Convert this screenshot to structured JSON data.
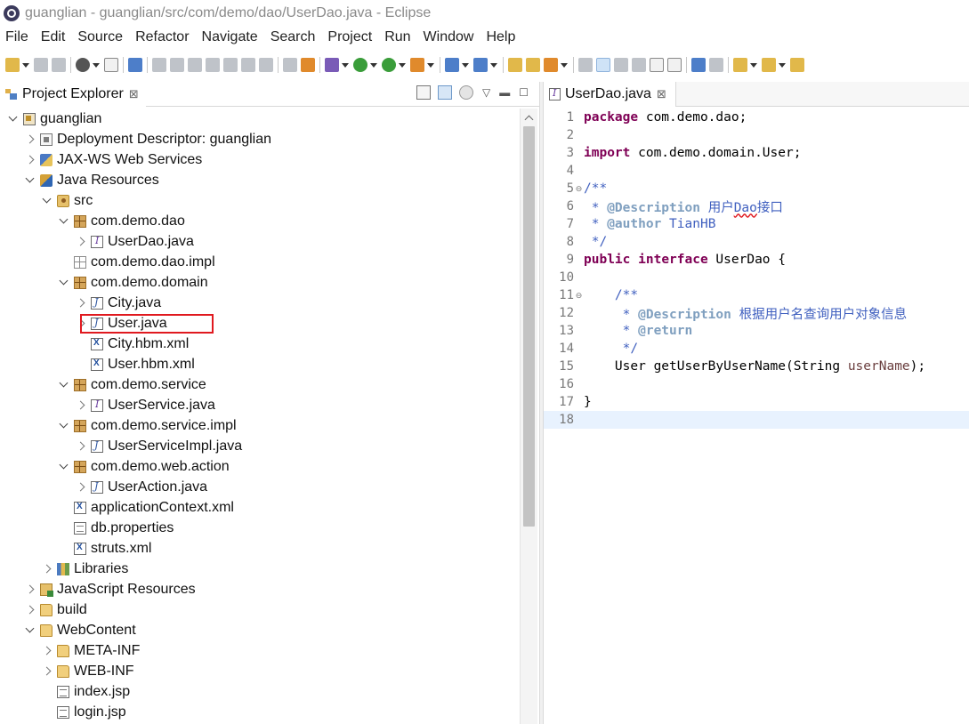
{
  "window": {
    "title": "guanglian - guanglian/src/com/demo/dao/UserDao.java - Eclipse"
  },
  "menu": [
    "File",
    "Edit",
    "Source",
    "Refactor",
    "Navigate",
    "Search",
    "Project",
    "Run",
    "Window",
    "Help"
  ],
  "explorer": {
    "title": "Project Explorer",
    "close": "⊠",
    "tree": [
      {
        "label": "guanglian",
        "icon": "project-icon",
        "twisty": "open"
      },
      {
        "label": "Deployment Descriptor: guanglian",
        "icon": "deployment-descriptor-icon",
        "twisty": "closed"
      },
      {
        "label": "JAX-WS Web Services",
        "icon": "web-services-icon",
        "twisty": "closed"
      },
      {
        "label": "Java Resources",
        "icon": "java-resources-icon",
        "twisty": "open"
      },
      {
        "label": "src",
        "icon": "source-folder-icon",
        "twisty": "open"
      },
      {
        "label": "com.demo.dao",
        "icon": "package-icon",
        "twisty": "open"
      },
      {
        "label": "UserDao.java",
        "icon": "interface-file-icon",
        "twisty": "closed"
      },
      {
        "label": "com.demo.dao.impl",
        "icon": "empty-package-icon",
        "twisty": "none"
      },
      {
        "label": "com.demo.domain",
        "icon": "package-icon",
        "twisty": "open"
      },
      {
        "label": "City.java",
        "icon": "java-file-icon",
        "twisty": "closed"
      },
      {
        "label": "User.java",
        "icon": "java-file-icon",
        "twisty": "closed"
      },
      {
        "label": "City.hbm.xml",
        "icon": "xml-file-icon",
        "twisty": "none"
      },
      {
        "label": "User.hbm.xml",
        "icon": "xml-file-icon",
        "twisty": "none"
      },
      {
        "label": "com.demo.service",
        "icon": "package-icon",
        "twisty": "open"
      },
      {
        "label": "UserService.java",
        "icon": "interface-file-icon",
        "twisty": "closed"
      },
      {
        "label": "com.demo.service.impl",
        "icon": "package-icon",
        "twisty": "open"
      },
      {
        "label": "UserServiceImpl.java",
        "icon": "java-file-icon",
        "twisty": "closed"
      },
      {
        "label": "com.demo.web.action",
        "icon": "package-icon",
        "twisty": "open"
      },
      {
        "label": "UserAction.java",
        "icon": "java-file-icon",
        "twisty": "closed"
      },
      {
        "label": "applicationContext.xml",
        "icon": "xml-file-icon",
        "twisty": "none"
      },
      {
        "label": "db.properties",
        "icon": "properties-file-icon",
        "twisty": "none"
      },
      {
        "label": "struts.xml",
        "icon": "xml-file-icon",
        "twisty": "none"
      },
      {
        "label": "Libraries",
        "icon": "libraries-icon",
        "twisty": "closed"
      },
      {
        "label": "JavaScript Resources",
        "icon": "javascript-resources-icon",
        "twisty": "closed"
      },
      {
        "label": "build",
        "icon": "folder-icon",
        "twisty": "closed"
      },
      {
        "label": "WebContent",
        "icon": "folder-icon",
        "twisty": "open"
      },
      {
        "label": "META-INF",
        "icon": "folder-icon",
        "twisty": "closed"
      },
      {
        "label": "WEB-INF",
        "icon": "folder-icon",
        "twisty": "closed"
      },
      {
        "label": "index.jsp",
        "icon": "jsp-file-icon",
        "twisty": "none"
      },
      {
        "label": "login.jsp",
        "icon": "jsp-file-icon",
        "twisty": "none"
      }
    ],
    "selected_item": "UserDao.java"
  },
  "editor": {
    "tab_label": "UserDao.java",
    "tab_close": "⊠",
    "line_numbers": [
      "1",
      "2",
      "3",
      "4",
      "5",
      "6",
      "7",
      "8",
      "9",
      "10",
      "11",
      "12",
      "13",
      "14",
      "15",
      "16",
      "17",
      "18"
    ],
    "code": {
      "l1_kw": "package",
      "l1_rest": " com.demo.dao;",
      "l3_kw": "import",
      "l3_rest": " com.demo.domain.User;",
      "l5": "/**",
      "l6_star": " * ",
      "l6_tag": "@Description",
      "l6_text_a": " 用户",
      "l6_text_dao": "Dao",
      "l6_text_b": "接口",
      "l7_star": " * ",
      "l7_tag": "@author",
      "l7_text": " TianHB",
      "l8": " */",
      "l9_kw1": "public",
      "l9_sp": " ",
      "l9_kw2": "interface",
      "l9_rest": " UserDao {",
      "l11": "    /**",
      "l12_star": "     * ",
      "l12_tag": "@Description",
      "l12_text": " 根据用户名查询用户对象信息",
      "l13_star": "     * ",
      "l13_tag": "@return",
      "l14": "     */",
      "l15_a": "    User getUserByUserName(String ",
      "l15_var": "userName",
      "l15_b": ");",
      "l17": "}"
    },
    "current_line": "18"
  },
  "colors": {
    "keyword": "#7f0055",
    "javadoc": "#3f5fbf",
    "javadoc_tag": "#7f9fbf",
    "highlight_box": "#e0191f",
    "current_line": "#e8f2fe"
  }
}
